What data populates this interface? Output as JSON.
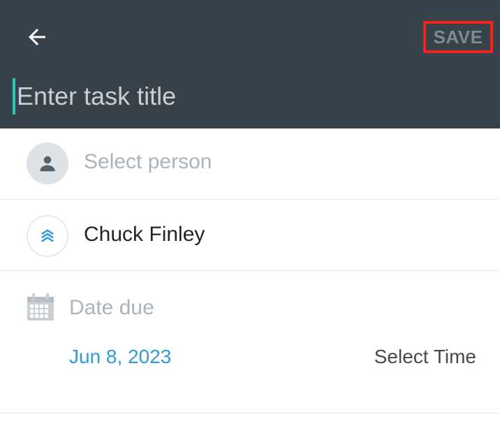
{
  "header": {
    "back_icon": "arrow-left-icon",
    "save_label": "SAVE",
    "title_placeholder": "Enter task title",
    "title_value": ""
  },
  "person": {
    "icon": "person-icon",
    "placeholder": "Select person"
  },
  "project": {
    "icon": "chevrons-up-logo",
    "name": "Chuck Finley"
  },
  "due": {
    "icon": "calendar-icon",
    "label": "Date due",
    "date": "Jun 8, 2023",
    "time_label": "Select Time"
  },
  "colors": {
    "header_bg": "#37424a",
    "accent": "#2ec4b6",
    "link": "#2f9bd8",
    "highlight_box": "#f0231e"
  }
}
